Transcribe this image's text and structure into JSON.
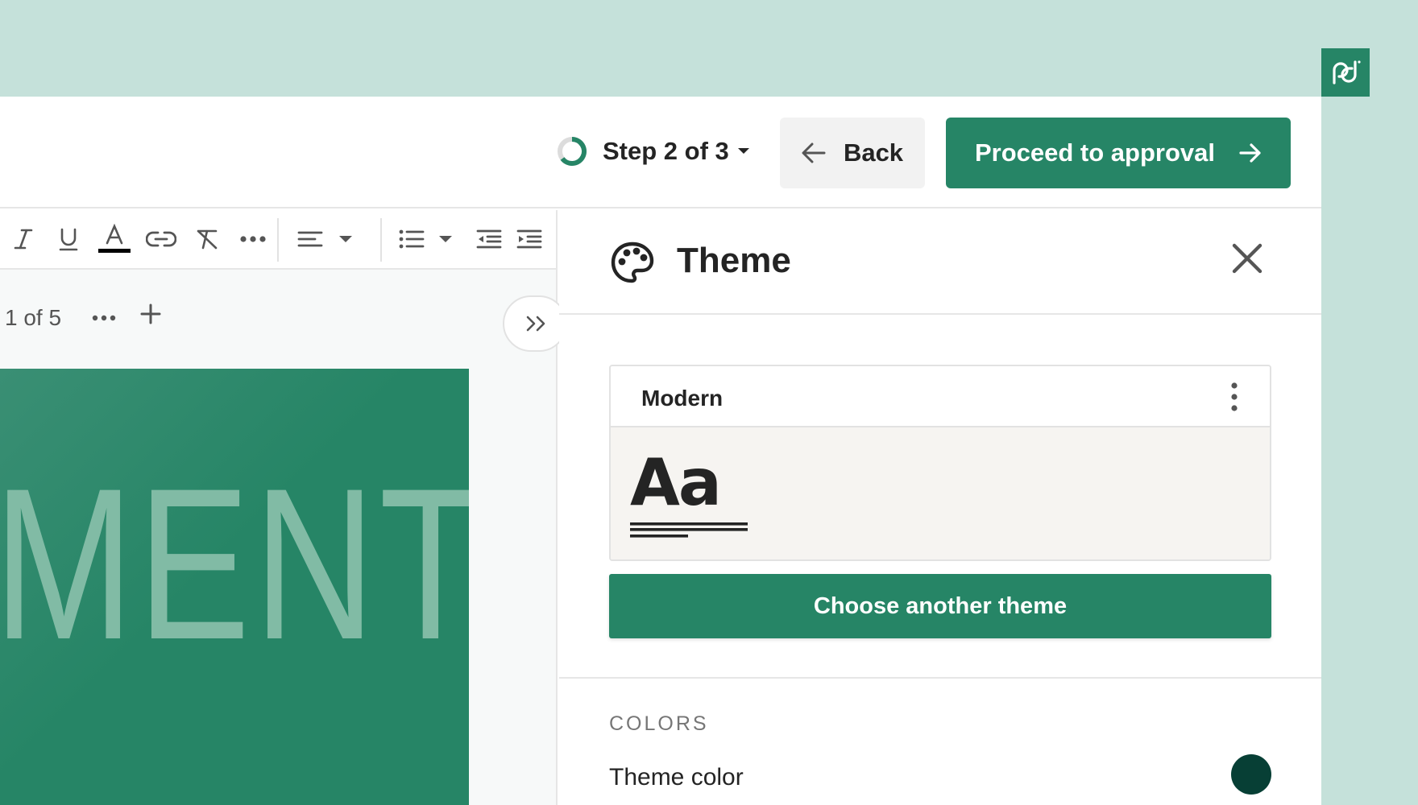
{
  "header": {
    "step_label": "Step 2 of 3",
    "back_label": "Back",
    "proceed_label": "Proceed to approval"
  },
  "toolbar": {
    "icons": [
      "italic-icon",
      "underline-icon",
      "text-color-icon",
      "link-icon",
      "clear-format-icon",
      "more-icon",
      "align-icon",
      "list-icon",
      "outdent-icon",
      "indent-icon"
    ],
    "text_color": "#000000"
  },
  "pager": {
    "page_count": "1 of 5"
  },
  "slide": {
    "text": "MENT",
    "background": "#268566",
    "text_color": "#81bba5"
  },
  "panel": {
    "title": "Theme",
    "theme_card": {
      "name": "Modern",
      "preview_text": "Aa"
    },
    "choose_label": "Choose another theme",
    "colors_heading": "COLORS",
    "theme_color_label": "Theme color",
    "theme_color": "#073f35"
  },
  "colors": {
    "brand": "#268566",
    "background": "#c5e1da"
  }
}
